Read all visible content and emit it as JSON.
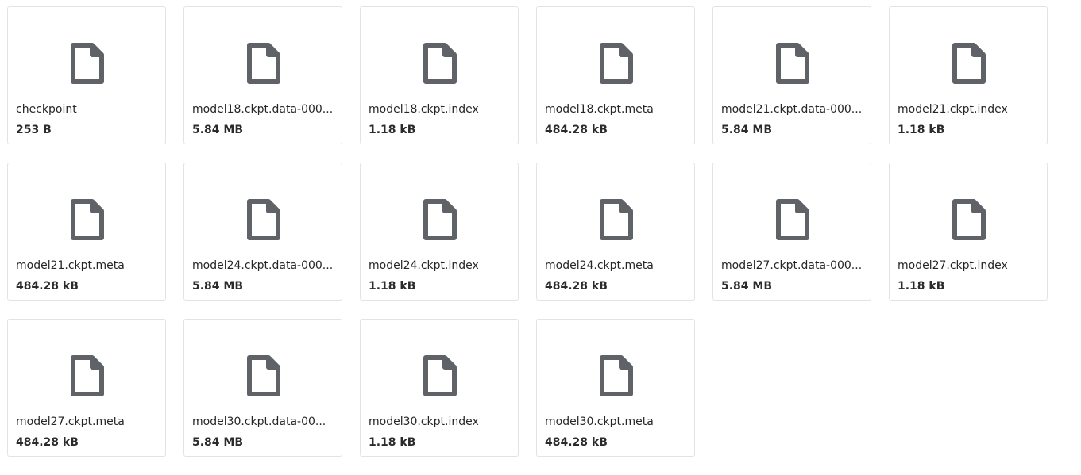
{
  "files": [
    {
      "name": "checkpoint",
      "size": "253 B",
      "icon": "file-icon"
    },
    {
      "name": "model18.ckpt.data-000...",
      "size": "5.84 MB",
      "icon": "file-icon"
    },
    {
      "name": "model18.ckpt.index",
      "size": "1.18 kB",
      "icon": "file-icon"
    },
    {
      "name": "model18.ckpt.meta",
      "size": "484.28 kB",
      "icon": "file-icon"
    },
    {
      "name": "model21.ckpt.data-000...",
      "size": "5.84 MB",
      "icon": "file-icon"
    },
    {
      "name": "model21.ckpt.index",
      "size": "1.18 kB",
      "icon": "file-icon"
    },
    {
      "name": "model21.ckpt.meta",
      "size": "484.28 kB",
      "icon": "file-icon"
    },
    {
      "name": "model24.ckpt.data-000...",
      "size": "5.84 MB",
      "icon": "file-icon"
    },
    {
      "name": "model24.ckpt.index",
      "size": "1.18 kB",
      "icon": "file-icon"
    },
    {
      "name": "model24.ckpt.meta",
      "size": "484.28 kB",
      "icon": "file-icon"
    },
    {
      "name": "model27.ckpt.data-000...",
      "size": "5.84 MB",
      "icon": "file-icon"
    },
    {
      "name": "model27.ckpt.index",
      "size": "1.18 kB",
      "icon": "file-icon"
    },
    {
      "name": "model27.ckpt.meta",
      "size": "484.28 kB",
      "icon": "file-icon"
    },
    {
      "name": "model30.ckpt.data-00...",
      "size": "5.84 MB",
      "icon": "file-icon"
    },
    {
      "name": "model30.ckpt.index",
      "size": "1.18 kB",
      "icon": "file-icon"
    },
    {
      "name": "model30.ckpt.meta",
      "size": "484.28 kB",
      "icon": "file-icon"
    }
  ],
  "colors": {
    "icon": "#5f6368",
    "border": "#e3e3e3"
  }
}
